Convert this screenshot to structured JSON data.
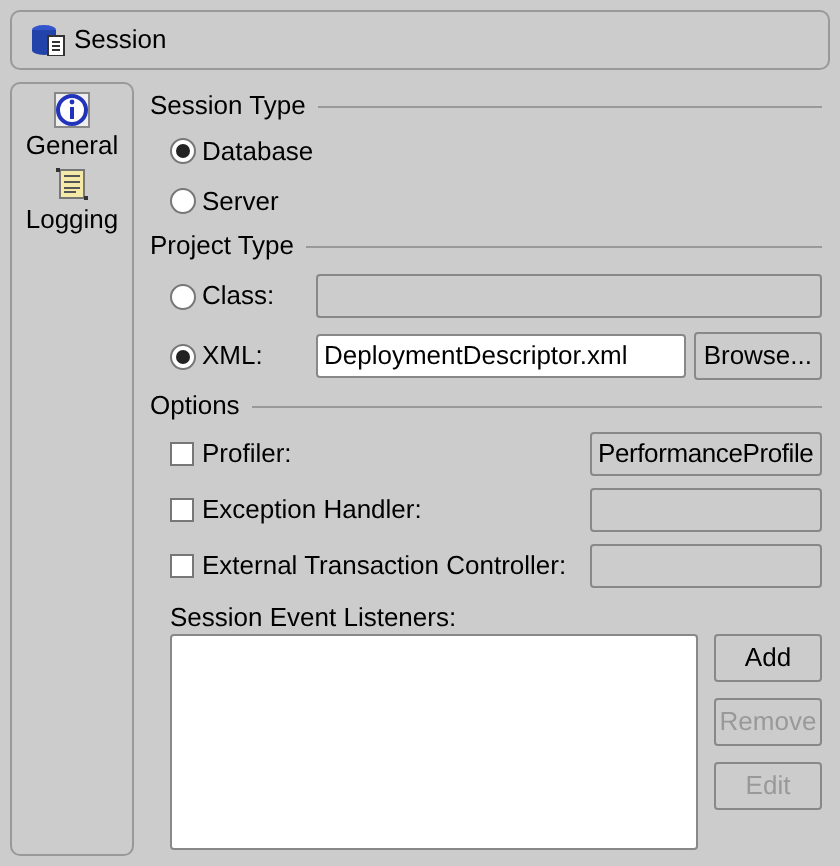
{
  "header": {
    "title": "Session"
  },
  "nav": [
    {
      "label": "General",
      "kind": "info"
    },
    {
      "label": "Logging",
      "kind": "log"
    }
  ],
  "session_type": {
    "title": "Session Type",
    "options": [
      {
        "label": "Database",
        "selected": true
      },
      {
        "label": "Server",
        "selected": false
      }
    ]
  },
  "project_type": {
    "title": "Project Type",
    "options": [
      {
        "label": "Class:",
        "selected": false
      },
      {
        "label": "XML:",
        "selected": true,
        "value": "DeploymentDescriptor.xml",
        "button": "Browse..."
      }
    ]
  },
  "options": {
    "title": "Options",
    "items": [
      {
        "label": "Profiler:",
        "checked": false,
        "value": "PerformanceProfile"
      },
      {
        "label": "Exception Handler:",
        "checked": false
      },
      {
        "label": "External Transaction Controller:",
        "checked": false
      }
    ],
    "listeners_label": "Session Event Listeners:",
    "buttons": [
      {
        "label": "Add",
        "disabled": false
      },
      {
        "label": "Remove",
        "disabled": true
      },
      {
        "label": "Edit",
        "disabled": true
      }
    ]
  }
}
